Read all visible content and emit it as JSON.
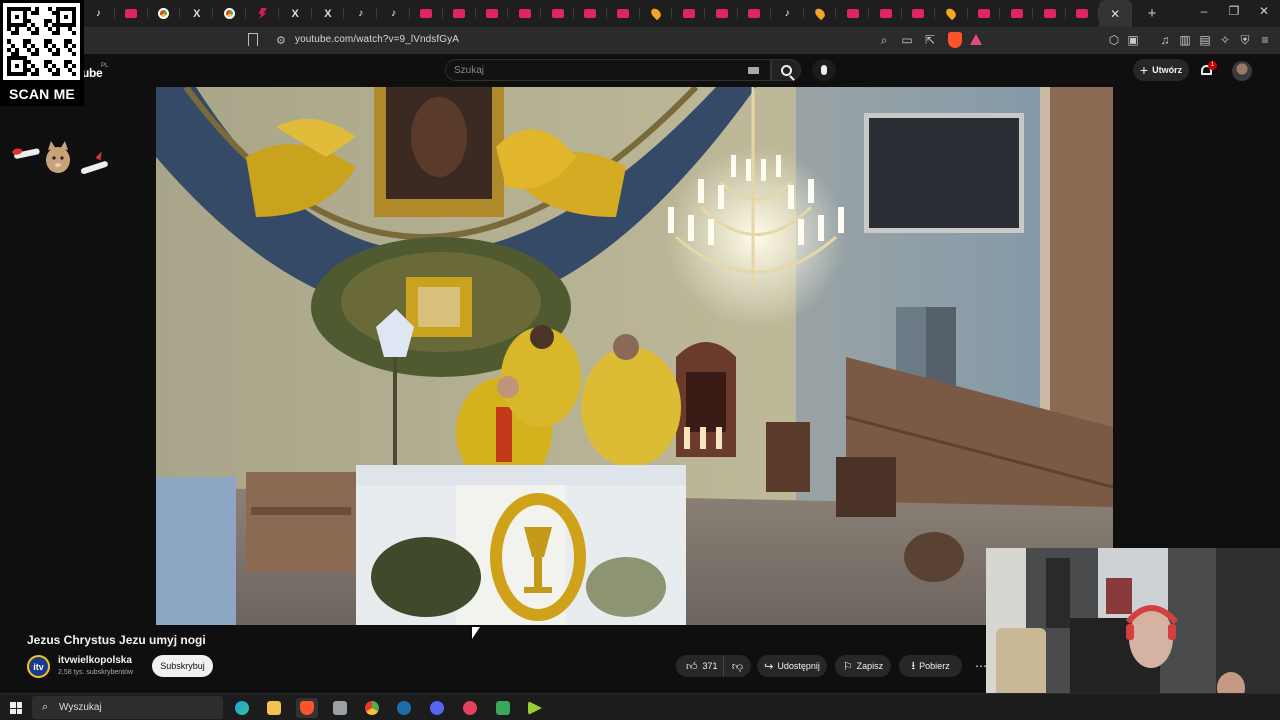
{
  "browser": {
    "tabs": [
      "tiktok",
      "youtube",
      "chrome",
      "x",
      "chrome",
      "bolt",
      "x",
      "x",
      "tiktok",
      "tiktok",
      "youtube",
      "youtube",
      "youtube",
      "youtube",
      "youtube",
      "youtube",
      "youtube",
      "location",
      "youtube",
      "youtube",
      "youtube",
      "tiktok",
      "location",
      "youtube",
      "youtube",
      "youtube",
      "location",
      "youtube",
      "youtube",
      "youtube",
      "youtube"
    ],
    "address": "youtube.com/watch?v=9_lVndsfGyA",
    "window_controls": {
      "minimize": "–",
      "restore": "❐",
      "close": "✕"
    },
    "new_tab": "+",
    "active_tab_close": "✕"
  },
  "overlay": {
    "scan_label": "SCAN ME"
  },
  "youtube": {
    "logo_text": "ube",
    "logo_region": "PL",
    "search_placeholder": "Szukaj",
    "create_label": "Utwórz",
    "notification_count": "1"
  },
  "video": {
    "title": "Jezus Chrystus Jezu umyj nogi",
    "channel": {
      "name": "itvwielkopolska",
      "subscribers": "2,58 tys. subskrybentów",
      "avatar_text": "itv"
    },
    "subscribe_label": "Subskrybuj",
    "likes": "371",
    "share_label": "Udostępnij",
    "save_label": "Zapisz",
    "download_label": "Pobierz",
    "more_label": "⋯"
  },
  "taskbar": {
    "search_text": "Wyszukaj",
    "apps": [
      "edge",
      "explorer",
      "brave",
      "app",
      "chrome",
      "steam",
      "discord",
      "app",
      "app",
      "app"
    ]
  },
  "colors": {
    "background": "#0f0f0f",
    "youtube_red": "#cc0000",
    "brave_orange": "#fb542b"
  }
}
